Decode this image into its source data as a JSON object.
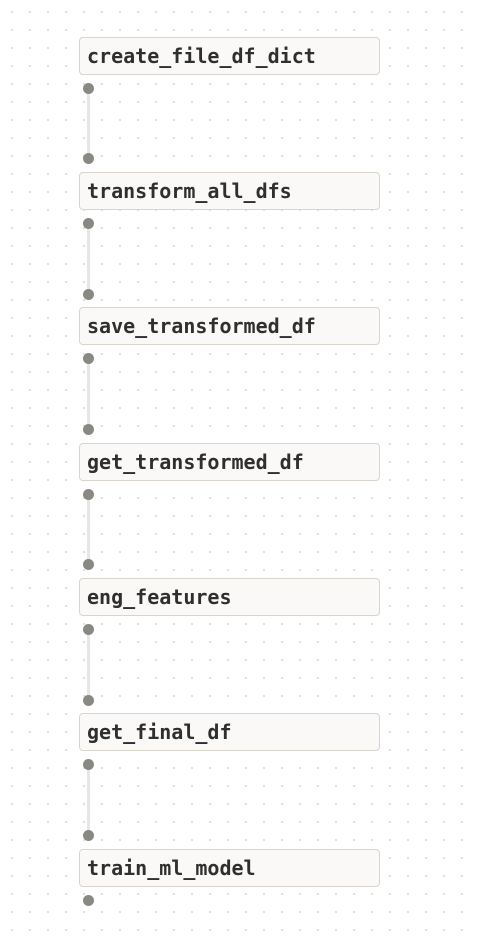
{
  "diagram": {
    "nodes": [
      {
        "id": "n1",
        "label": "create_file_df_dict"
      },
      {
        "id": "n2",
        "label": "transform_all_dfs"
      },
      {
        "id": "n3",
        "label": "save_transformed_df"
      },
      {
        "id": "n4",
        "label": "get_transformed_df"
      },
      {
        "id": "n5",
        "label": "eng_features"
      },
      {
        "id": "n6",
        "label": "get_final_df"
      },
      {
        "id": "n7",
        "label": "train_ml_model"
      }
    ],
    "edges": [
      {
        "from": "n1",
        "to": "n2"
      },
      {
        "from": "n2",
        "to": "n3"
      },
      {
        "from": "n3",
        "to": "n4"
      },
      {
        "from": "n4",
        "to": "n5"
      },
      {
        "from": "n5",
        "to": "n6"
      },
      {
        "from": "n6",
        "to": "n7"
      }
    ],
    "colors": {
      "node_border": "#d9d5cc",
      "node_fill": "#faf9f7",
      "port": "#8a8883",
      "edge": "#e6e6e4",
      "text": "#2f2f2f"
    }
  }
}
